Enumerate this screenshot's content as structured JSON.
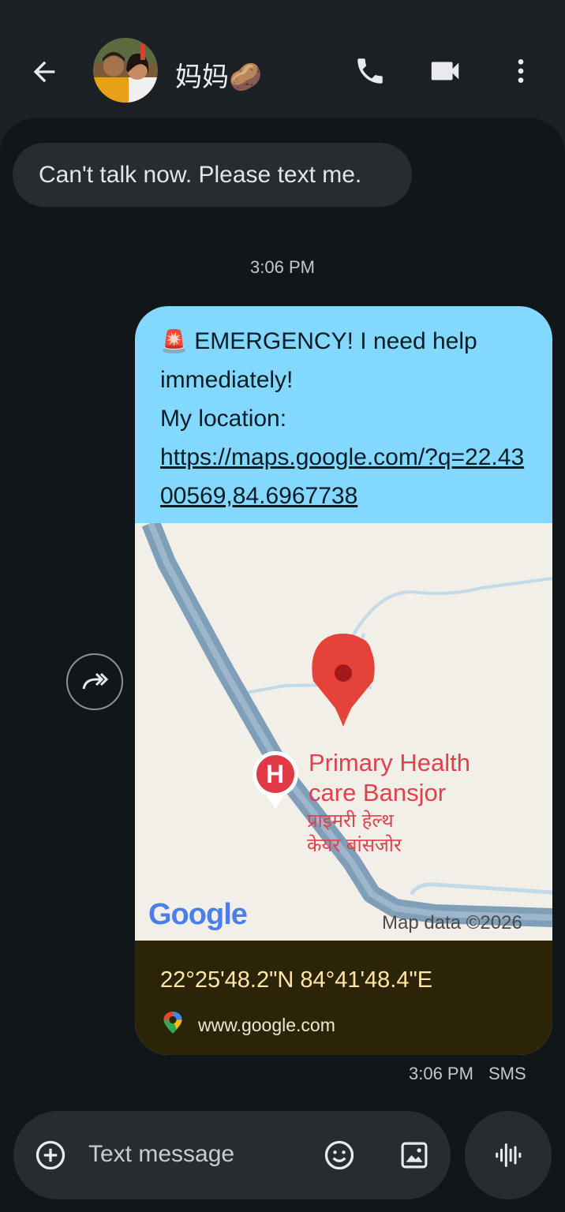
{
  "header": {
    "contact_name": "妈妈🥔",
    "icons": [
      "back-arrow-icon",
      "phone-icon",
      "video-call-icon",
      "more-vert-icon"
    ]
  },
  "messages": {
    "incoming_text": "Can't talk now. Please text me.",
    "timestamp": "3:06 PM",
    "outgoing": {
      "emoji": "🚨",
      "line1": "EMERGENCY! I need help immediately!",
      "line2": "My location:",
      "link": "https://maps.google.com/?q=22.4300569,84.6967738",
      "map": {
        "place_name_en_1": "Primary Health",
        "place_name_en_2": "care Bansjor",
        "place_name_hi_1": "प्राइमरी हेल्थ",
        "place_name_hi_2": "केयर बांसजोर",
        "marker_letter": "H",
        "google_logo": "Google",
        "attribution": "Map data ©2026"
      },
      "coords": "22°25'48.2\"N 84°41'48.4\"E",
      "site": "www.google.com",
      "time": "3:06 PM",
      "type": "SMS"
    }
  },
  "composer": {
    "placeholder": "Text message",
    "icons": [
      "add-circle-icon",
      "emoji-icon",
      "image-icon",
      "voice-wave-icon"
    ]
  },
  "colors": {
    "background": "#111619",
    "header_bg": "#1b2025",
    "incoming_bubble": "#272c31",
    "outgoing_bubble": "#82d8ff",
    "map_footer": "#2c2409",
    "pin_red": "#d93025"
  }
}
